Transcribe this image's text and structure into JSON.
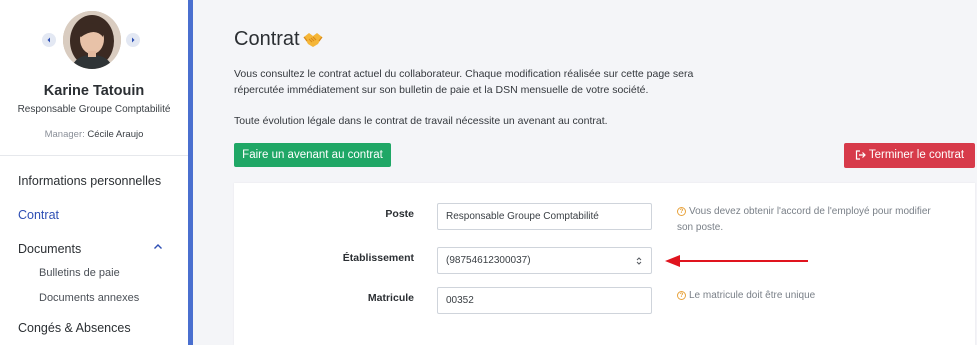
{
  "employee": {
    "name": "Karine Tatouin",
    "role": "Responsable Groupe Comptabilité",
    "manager_label": "Manager:",
    "manager_name": "Cécile Araujo"
  },
  "sidebar": {
    "items": [
      {
        "label": "Informations personnelles"
      },
      {
        "label": "Contrat",
        "active": true
      },
      {
        "label": "Documents",
        "expanded": true
      },
      {
        "label": "Congés & Absences"
      }
    ],
    "documents_subitems": [
      {
        "label": "Bulletins de paie"
      },
      {
        "label": "Documents annexes"
      }
    ]
  },
  "page": {
    "title": "Contrat",
    "title_emoji_icon": "handshake-icon",
    "description_line1": "Vous consultez le contrat actuel du collaborateur. Chaque modification réalisée sur cette page sera",
    "description_line2": "répercutée immédiatement sur son bulletin de paie et la DSN mensuelle de votre société.",
    "description_line3": "Toute évolution légale dans le contrat de travail nécessite un avenant au contrat."
  },
  "actions": {
    "avenant_label": "Faire un avenant au contrat",
    "terminer_label": "Terminer le contrat"
  },
  "form": {
    "poste_label": "Poste",
    "poste_value": "Responsable Groupe Comptabilité",
    "poste_hint_line1": "Vous devez obtenir l'accord de l'employé pour modifier",
    "poste_hint_line2": "son poste.",
    "etablissement_label": "Établissement",
    "etablissement_value": "(98754612300037)",
    "matricule_label": "Matricule",
    "matricule_value": "00352",
    "matricule_hint": "Le matricule doit être unique",
    "hint_icon_glyph": "?"
  },
  "colors": {
    "accent_blue": "#4a6fcf",
    "active_link": "#2e4fb4",
    "primary_green": "#1fa766",
    "danger_red": "#d73a4a",
    "hint_orange": "#e8a33d",
    "annotation_arrow": "#e0141e"
  }
}
